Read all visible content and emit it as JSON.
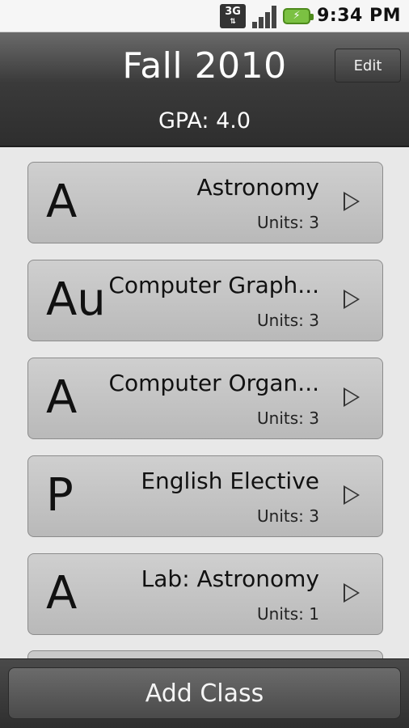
{
  "status_bar": {
    "network_label": "3G",
    "time": "9:34 PM"
  },
  "header": {
    "title": "Fall 2010",
    "edit_label": "Edit",
    "gpa": "GPA: 4.0"
  },
  "courses": [
    {
      "grade": "A",
      "name": "Astronomy",
      "units": "Units: 3"
    },
    {
      "grade": "Au",
      "name": "Computer Graph...",
      "units": "Units: 3"
    },
    {
      "grade": "A",
      "name": "Computer Organ...",
      "units": "Units: 3"
    },
    {
      "grade": "P",
      "name": "English Elective",
      "units": "Units: 3"
    },
    {
      "grade": "A",
      "name": "Lab: Astronomy",
      "units": "Units: 1"
    }
  ],
  "footer": {
    "add_label": "Add Class"
  }
}
